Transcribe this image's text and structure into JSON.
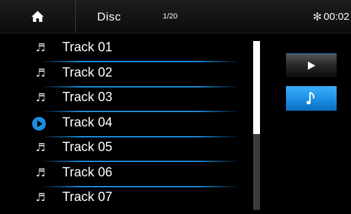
{
  "header": {
    "source": "Disc",
    "counter": "1/20",
    "time": "00:02",
    "bluetooth_glyph": "✻"
  },
  "tracks": [
    {
      "label": "Track 01",
      "state": "idle"
    },
    {
      "label": "Track 02",
      "state": "idle"
    },
    {
      "label": "Track 03",
      "state": "idle"
    },
    {
      "label": "Track 04",
      "state": "playing"
    },
    {
      "label": "Track 05",
      "state": "idle"
    },
    {
      "label": "Track 06",
      "state": "idle"
    },
    {
      "label": "Track 07",
      "state": "idle"
    }
  ],
  "colors": {
    "accent": "#1a8fe0",
    "background": "#000000"
  },
  "icons": {
    "home": "home-icon",
    "track": "music-note-icon",
    "playing": "play-circle-icon",
    "play": "play-icon",
    "music": "music-note-icon"
  }
}
